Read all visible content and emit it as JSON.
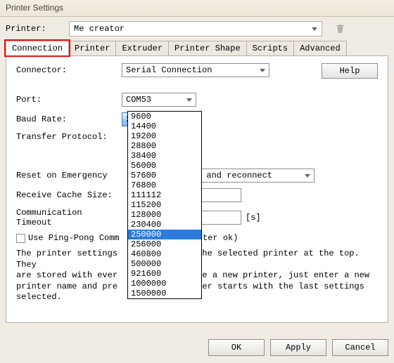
{
  "title": "Printer Settings",
  "printer_label": "Printer:",
  "printer_name": "Me creator",
  "tabs": {
    "connection": "Connection",
    "printer": "Printer",
    "extruder": "Extruder",
    "shape": "Printer Shape",
    "scripts": "Scripts",
    "advanced": "Advanced"
  },
  "help_label": "Help",
  "fields": {
    "connector": {
      "label": "Connector:",
      "value": "Serial Connection"
    },
    "port": {
      "label": "Port:",
      "value": "COM53"
    },
    "baud": {
      "label": "Baud Rate:",
      "value": "250000"
    },
    "transfer": {
      "label": "Transfer Protocol:"
    },
    "reset": {
      "label": "Reset on Emergency",
      "value_tail": "d and reconnect"
    },
    "cache": {
      "label": "Receive Cache Size:",
      "value": ""
    },
    "timeout": {
      "label": "Communication Timeout",
      "value": "",
      "unit": "[s]"
    },
    "pingpong": {
      "label": "Use Ping-Pong Comm",
      "suffix": "after ok)"
    }
  },
  "baud_options": [
    "9600",
    "14400",
    "19200",
    "28800",
    "38400",
    "56000",
    "57600",
    "76800",
    "111112",
    "115200",
    "128000",
    "230400",
    "250000",
    "256000",
    "460800",
    "500000",
    "921600",
    "1000000",
    "1500000"
  ],
  "baud_selected_index": 12,
  "info_text": "The printer settings always correspond to the selected printer at the top. They are stored with every change. To create a new printer, just enter a new printer name and press enter. The new printer starts with the last settings selected.",
  "info_line1": "The printer settings",
  "info_line1b": " the selected printer at the top. They",
  "info_line2": "are stored with ever",
  "info_line2b": "ate a new printer, just enter a new",
  "info_line3": "printer name and pre",
  "info_line3b": "iter starts with the last settings",
  "info_line4": "selected.",
  "buttons": {
    "ok": "OK",
    "apply": "Apply",
    "cancel": "Cancel"
  }
}
